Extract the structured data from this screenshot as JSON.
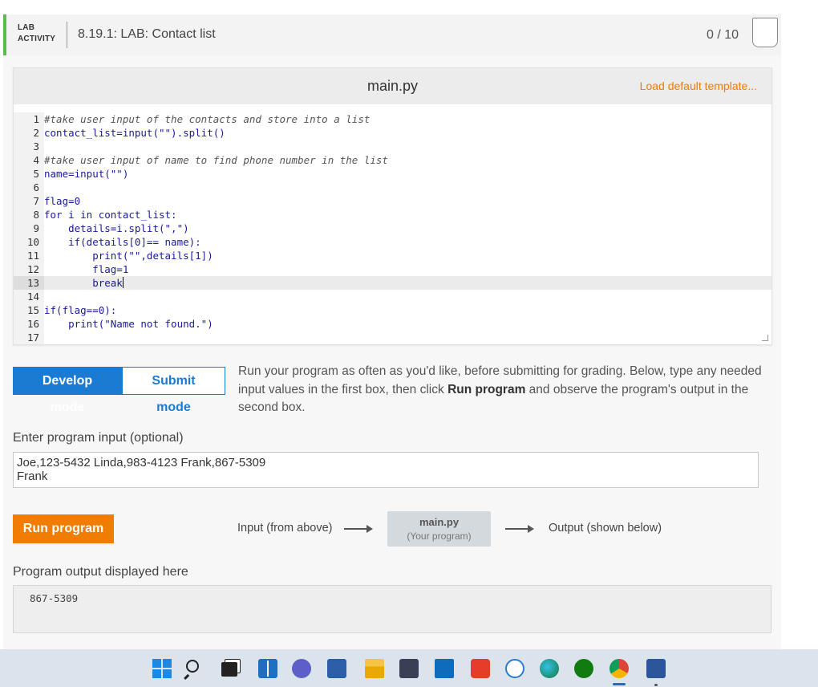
{
  "header": {
    "tag_line1": "LAB",
    "tag_line2": "ACTIVITY",
    "title": "8.19.1: LAB: Contact list",
    "score": "0 / 10"
  },
  "editor": {
    "file_name": "main.py",
    "load_template": "Load default template...",
    "lines": [
      {
        "n": "1",
        "text": "#take user input of the contacts and store into a list",
        "kind": "comment"
      },
      {
        "n": "2",
        "text": "contact_list=input(\"\").split()",
        "kind": "code"
      },
      {
        "n": "3",
        "text": "",
        "kind": "code"
      },
      {
        "n": "4",
        "text": "#take user input of name to find phone number in the list",
        "kind": "comment"
      },
      {
        "n": "5",
        "text": "name=input(\"\")",
        "kind": "code"
      },
      {
        "n": "6",
        "text": "",
        "kind": "code"
      },
      {
        "n": "7",
        "text": "flag=0",
        "kind": "code"
      },
      {
        "n": "8",
        "text": "for i in contact_list:",
        "kind": "code"
      },
      {
        "n": "9",
        "text": "    details=i.split(\",\")",
        "kind": "code"
      },
      {
        "n": "10",
        "text": "    if(details[0]== name):",
        "kind": "code"
      },
      {
        "n": "11",
        "text": "        print(\"\",details[1])",
        "kind": "code"
      },
      {
        "n": "12",
        "text": "        flag=1",
        "kind": "code"
      },
      {
        "n": "13",
        "text": "        break",
        "kind": "code"
      },
      {
        "n": "14",
        "text": "",
        "kind": "code"
      },
      {
        "n": "15",
        "text": "if(flag==0):",
        "kind": "code"
      },
      {
        "n": "16",
        "text": "    print(\"Name not found.\")",
        "kind": "code"
      },
      {
        "n": "17",
        "text": "",
        "kind": "code"
      }
    ],
    "active_line": 13
  },
  "modes": {
    "develop": "Develop mode",
    "submit": "Submit mode"
  },
  "instructions": {
    "part1": "Run your program as often as you'd like, before submitting for grading. Below, type any needed input values in the first box, then click ",
    "bold": "Run program",
    "part2": " and observe the program's output in the second box."
  },
  "input": {
    "label": "Enter program input (optional)",
    "value": "Joe,123-5432 Linda,983-4123 Frank,867-5309\nFrank"
  },
  "run": {
    "button": "Run program",
    "flow_in": "Input (from above)",
    "prog_name": "main.py",
    "prog_sub": "(Your program)",
    "flow_out": "Output (shown below)"
  },
  "output": {
    "label": "Program output displayed here",
    "value": "867-5309"
  },
  "taskbar": {
    "icons": [
      "windows-start-icon",
      "search-icon",
      "task-view-icon",
      "widgets-icon",
      "chat-icon",
      "editor-app-icon",
      "file-explorer-icon",
      "store-icon",
      "mail-icon",
      "office-icon",
      "maps-icon",
      "edge-icon",
      "xbox-icon",
      "chrome-icon",
      "word-icon"
    ]
  },
  "colors": {
    "accent_green": "#5dbb4d",
    "primary_blue": "#1b7bd3",
    "orange": "#f07c00"
  }
}
